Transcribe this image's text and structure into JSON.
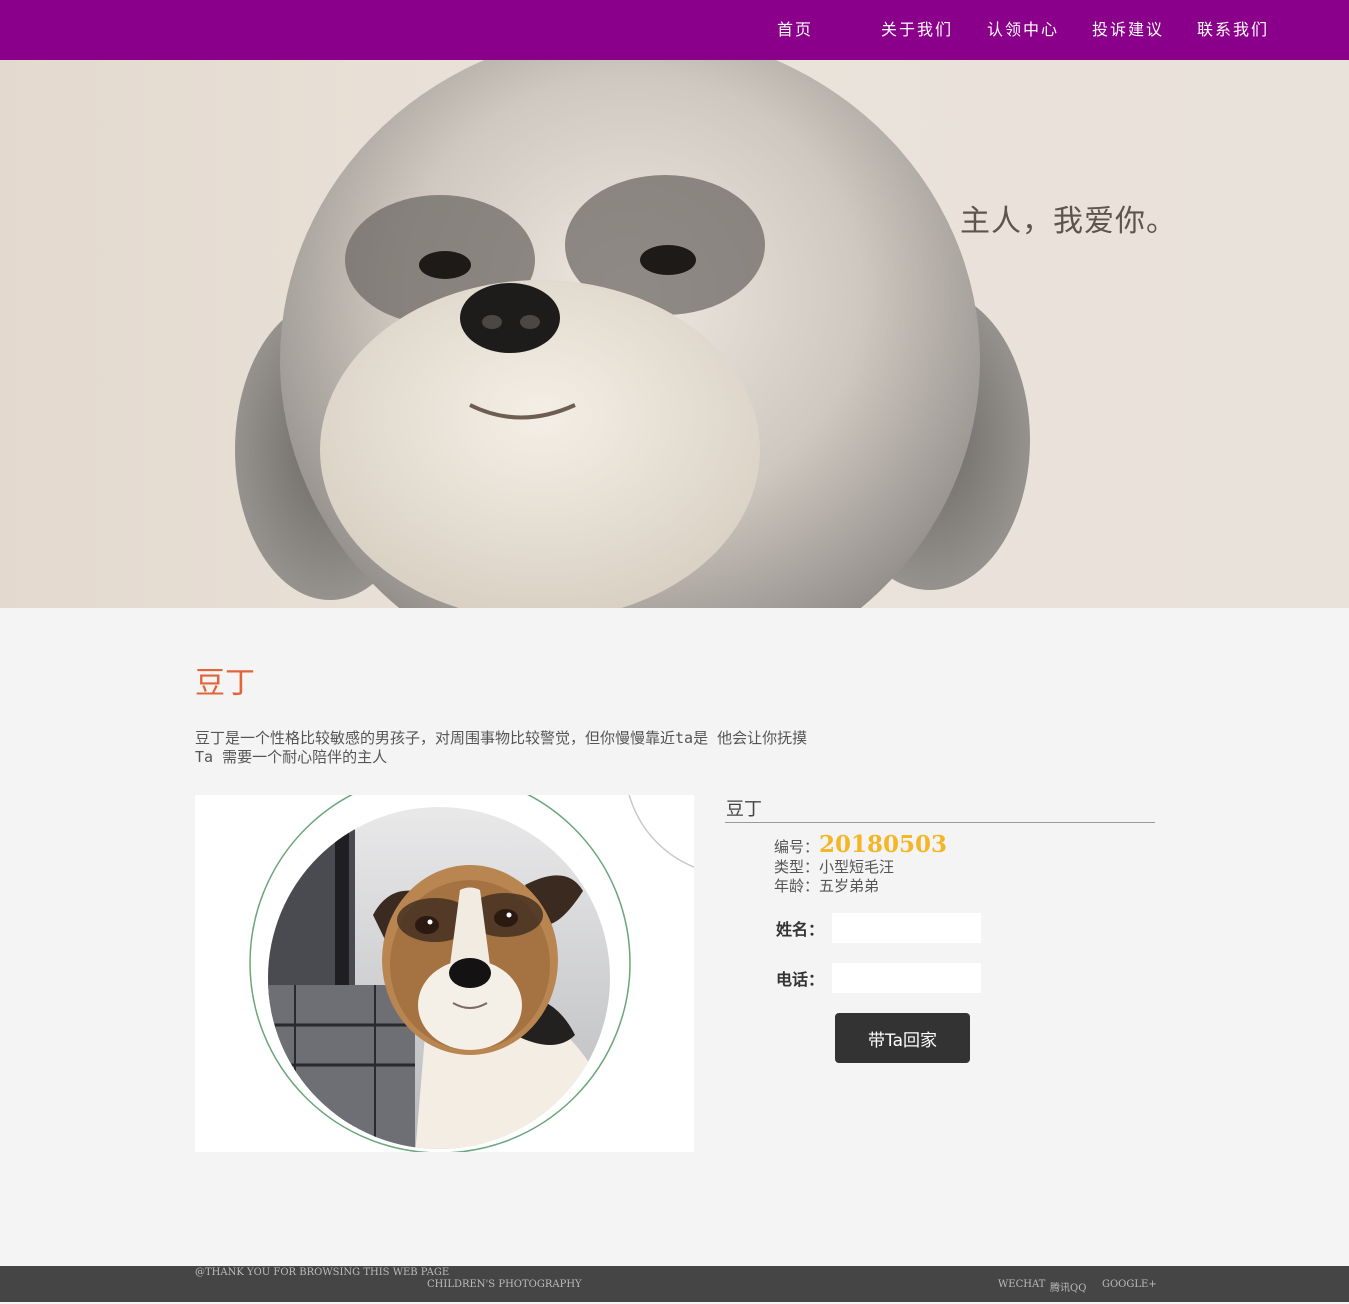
{
  "nav": {
    "items": [
      {
        "label": "首页"
      },
      {
        "label": "关于我们"
      },
      {
        "label": "认领中心"
      },
      {
        "label": "投诉建议"
      },
      {
        "label": "联系我们"
      }
    ]
  },
  "banner": {
    "caption": "主人，我爱你。"
  },
  "pet": {
    "title": "豆丁",
    "description": [
      "豆丁是一个性格比较敏感的男孩子，对周围事物比较警觉，但你慢慢靠近ta是 他会让你抚摸",
      "Ta 需要一个耐心陪伴的主人"
    ],
    "name": "豆丁",
    "id_label": "编号：",
    "id_value": "20180503",
    "type_text": "类型：小型短毛汪",
    "age_text": "年龄：五岁弟弟"
  },
  "form": {
    "name_label": "姓名：",
    "name_value": "",
    "phone_label": "电话：",
    "phone_value": "",
    "submit_label": "带Ta回家"
  },
  "footer": {
    "thanks": "@THANK YOU FOR BROWSING THIS WEB PAGE",
    "subtitle": "CHILDREN'S PHOTOGRAPHY",
    "links": [
      "WECHAT",
      "腾讯QQ",
      "GOOGLE+"
    ]
  },
  "colors": {
    "nav_bg": "#8b008b",
    "title": "#e2643b",
    "id_value": "#f4b526",
    "button_bg": "#333333",
    "footer_bg": "#454545",
    "page_bg": "#f4f4f4"
  }
}
